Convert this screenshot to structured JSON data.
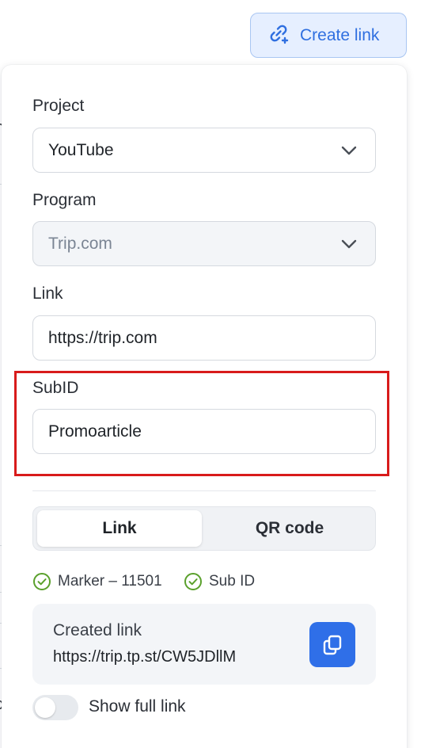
{
  "header": {
    "create_link_label": "Create link"
  },
  "form": {
    "project": {
      "label": "Project",
      "value": "YouTube"
    },
    "program": {
      "label": "Program",
      "value": "Trip.com"
    },
    "link": {
      "label": "Link",
      "value": "https://trip.com"
    },
    "subid": {
      "label": "SubID",
      "value": "Promoarticle"
    }
  },
  "tabs": [
    {
      "label": "Link",
      "active": true
    },
    {
      "label": "QR code",
      "active": false
    }
  ],
  "checks": [
    {
      "label": "Marker – 11501"
    },
    {
      "label": "Sub ID"
    }
  ],
  "result": {
    "title": "Created link",
    "url": "https://trip.tp.st/CW5JDllM"
  },
  "toggle": {
    "label": "Show full link",
    "on": false
  },
  "colors": {
    "accent": "#2f6fe8",
    "highlight_border": "#d81b1b",
    "check_green": "#5aa02c"
  }
}
